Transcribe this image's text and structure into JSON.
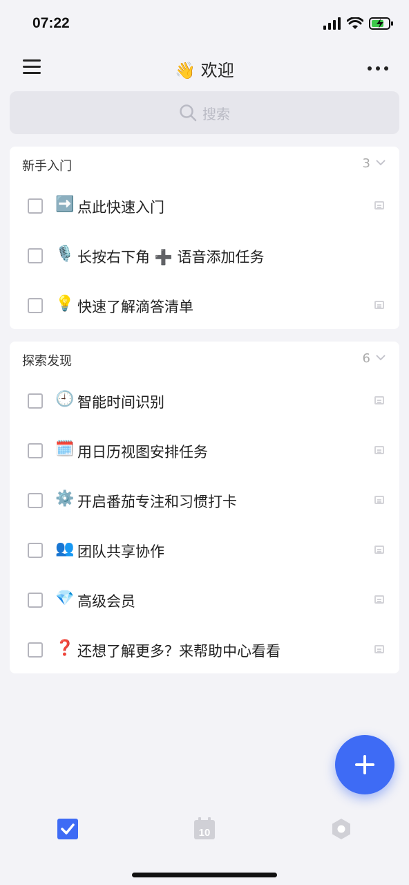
{
  "status_bar": {
    "time": "07:22"
  },
  "header": {
    "title_emoji": "👋",
    "title": "欢迎"
  },
  "search": {
    "placeholder": "搜索"
  },
  "sections": [
    {
      "title": "新手入门",
      "count": "3",
      "tasks": [
        {
          "emoji": "➡️",
          "text": "点此快速入门",
          "has_note": true
        },
        {
          "emoji": "🎙️",
          "text": "长按右下角 ➕ 语音添加任务",
          "has_note": false
        },
        {
          "emoji": "💡",
          "text": "快速了解滴答清单",
          "has_note": true
        }
      ]
    },
    {
      "title": "探索发现",
      "count": "6",
      "tasks": [
        {
          "emoji": "🕘",
          "text": "智能时间识别",
          "has_note": true
        },
        {
          "emoji": "🗓️",
          "text": "用日历视图安排任务",
          "has_note": true
        },
        {
          "emoji": "⚙️",
          "text": "开启番茄专注和习惯打卡",
          "has_note": true
        },
        {
          "emoji": "👥",
          "text": "团队共享协作",
          "has_note": true
        },
        {
          "emoji": "💎",
          "text": "高级会员",
          "has_note": true
        },
        {
          "emoji": "❓",
          "text": "还想了解更多？来帮助中心看看",
          "has_note": true
        }
      ]
    }
  ],
  "tabbar": {
    "calendar_day": "10"
  },
  "colors": {
    "accent": "#3e6bf5",
    "background": "#f3f3f7",
    "tab_inactive": "#d0d0d6"
  },
  "icons": {
    "menu": "hamburger-icon",
    "more": "more-dots-icon",
    "search": "search-icon",
    "fab": "plus-icon",
    "tab_tasks": "checkbox-checked-icon",
    "tab_calendar": "calendar-icon",
    "tab_settings": "hexagon-settings-icon"
  }
}
